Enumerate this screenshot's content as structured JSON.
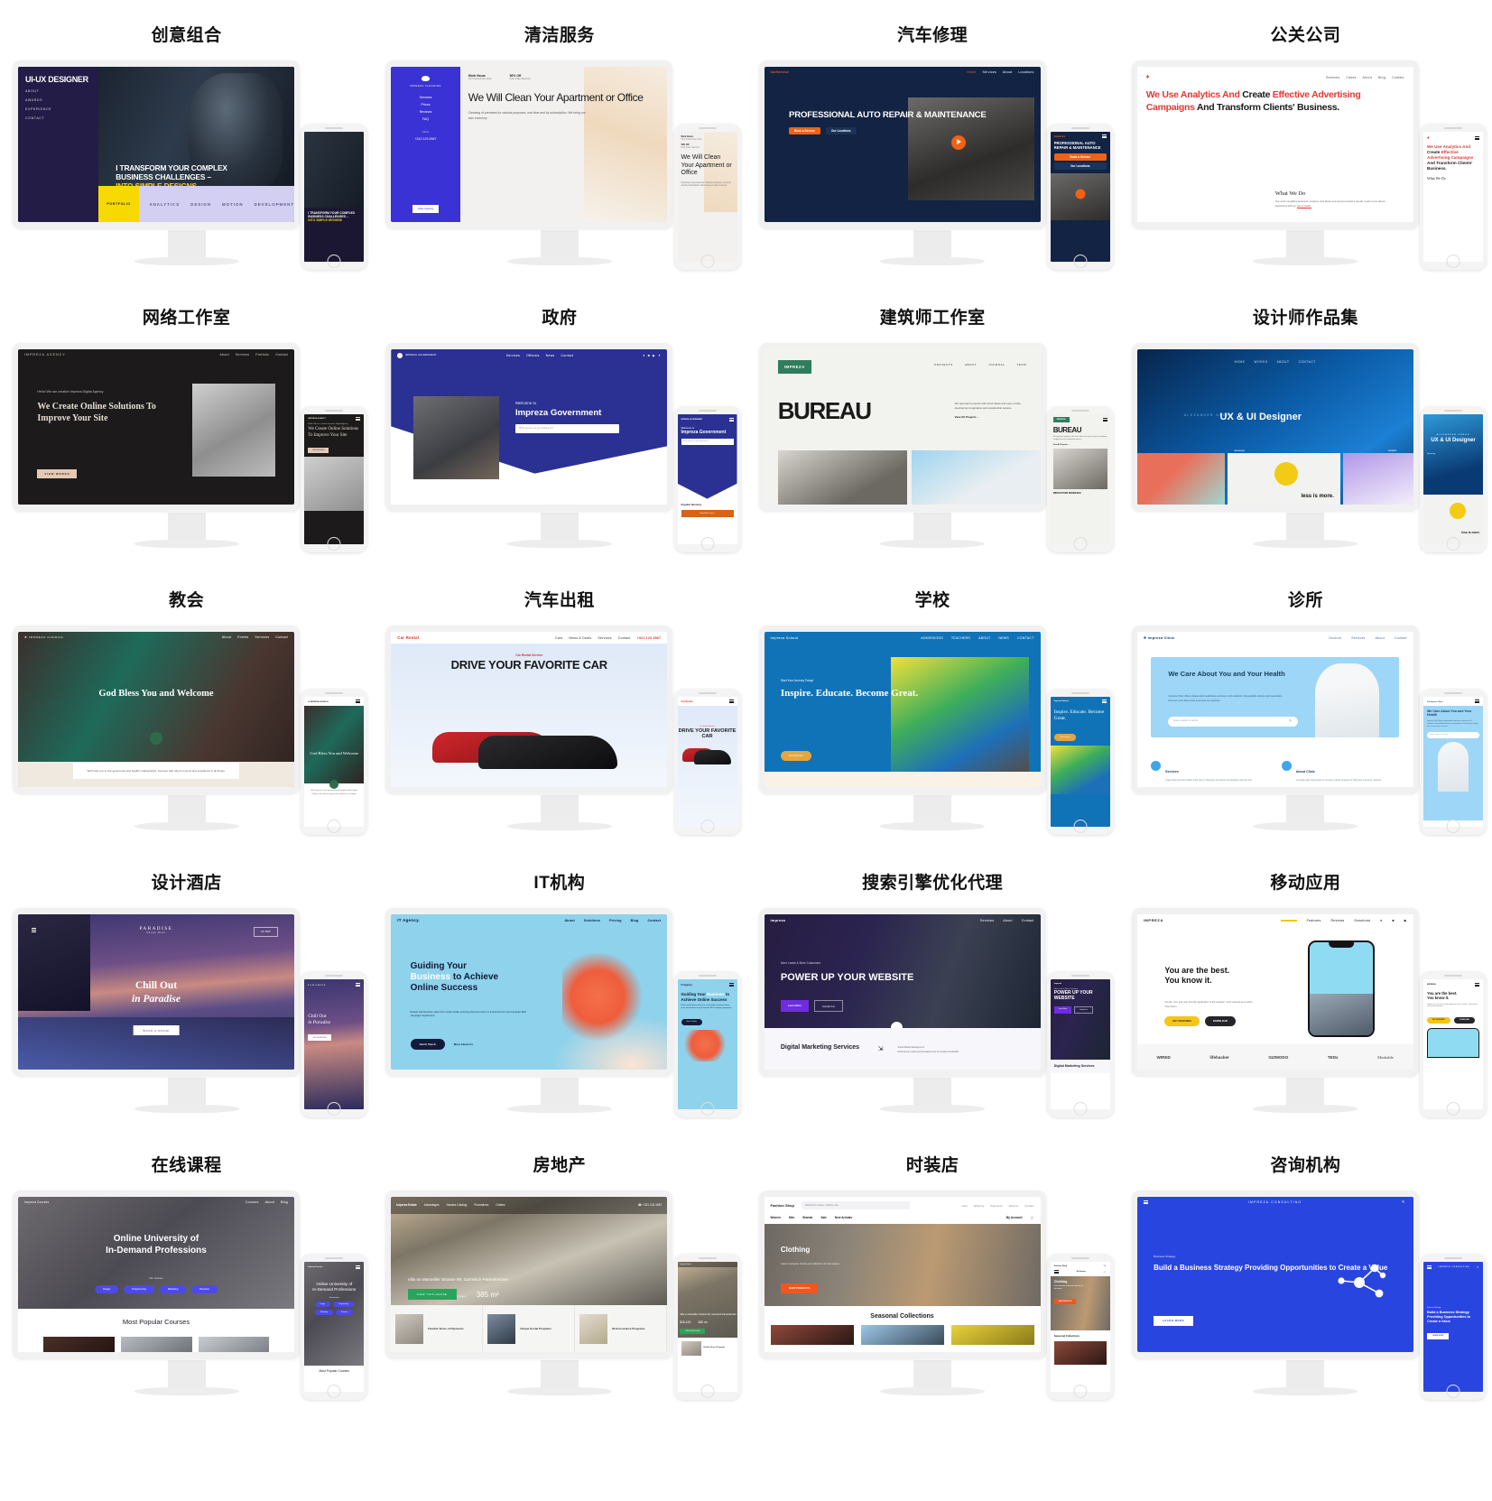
{
  "layout": {
    "columns": 4,
    "rows": 5
  },
  "cells": [
    {
      "title": "创意组合",
      "site": {
        "logo": "UI-UX DESIGNER",
        "menu": [
          "ABOUT",
          "AWARDS",
          "EXPERIENCE",
          "CONTACT"
        ],
        "heading_line1": "I TRANSFORM YOUR COMPLEX",
        "heading_line2": "BUSINESS CHALLENGES –",
        "heading_accent": "INTO SIMPLE DESIGNS",
        "footer_tag": "PORTFOLIO",
        "footer_items": [
          "ANALYTICS",
          "DESIGN",
          "MOTION",
          "DEVELOPMENT"
        ],
        "accent": "#f5d900",
        "bg": "#221c46"
      }
    },
    {
      "title": "清洁服务",
      "site": {
        "logo": "IMPREZA CLEANING",
        "menu": [
          "Services",
          "Prices",
          "Reviews",
          "FAQ"
        ],
        "phone_label": "Call Us",
        "phone": "+312 123 4567",
        "badge1_title": "Work Hours",
        "badge1_text": "24/7 Around the clock",
        "badge2_title": "50% Off",
        "badge2_text": "First order discount",
        "heading": "We Will Clean Your Apartment or Office",
        "paragraph": "Cleaning of premises for various purposes, one-time and by subscription. We bring our own inventory",
        "cta": "Order Cleaning",
        "accent": "#3a32d4"
      }
    },
    {
      "title": "汽车修理",
      "site": {
        "logo": "CarService",
        "menu": [
          "Home",
          "Services",
          "About",
          "Locations"
        ],
        "heading": "PROFESSIONAL AUTO REPAIR & MAINTENANCE",
        "cta_primary": "Book a Service",
        "cta_secondary": "Our Locations",
        "accent": "#ef6216",
        "bg": "#122343"
      }
    },
    {
      "title": "公关公司",
      "site": {
        "logo": "diamond-logo",
        "menu": [
          "Services",
          "Cases",
          "About",
          "Blog",
          "Contact"
        ],
        "heading_parts": [
          {
            "text": "We Use Analytics And ",
            "accent": true
          },
          {
            "text": "Create ",
            "accent": false
          },
          {
            "text": "Effective Advertising Campaigns ",
            "accent": true
          },
          {
            "text": "And Transform Clients' Business.",
            "accent": false
          }
        ],
        "section_title": "What We Do",
        "section_text": "Our work simplifies business, inspires new ideas and serves people's needs. Learn more about partnering with us,",
        "section_link": "get in touch.",
        "accent": "#e03a35"
      }
    },
    {
      "title": "网络工作室",
      "site": {
        "logo": "IMPREZA AGENCY",
        "menu": [
          "About",
          "Services",
          "Portfolio",
          "Contact"
        ],
        "eyebrow": "Hello! We are creative Impreza Digital Agency",
        "heading": "We Create Online Solutions To Improve Your Site",
        "cta": "VIEW WORKS",
        "accent": "#e3c9b4",
        "bg": "#1c1a1b"
      }
    },
    {
      "title": "政府",
      "site": {
        "logo": "IMPREZA GOVERNMENT",
        "menu": [
          "Services",
          "Officials",
          "News",
          "Contact"
        ],
        "eyebrow": "Welcome to",
        "heading": "Impreza Government",
        "search_placeholder": "What service are you looking for?",
        "mobile_section": "Popular Services",
        "mobile_cta": "View All Services",
        "accent": "#2a3192"
      }
    },
    {
      "title": "建筑师工作室",
      "site": {
        "logo": "IMPREZA",
        "menu": [
          "PROJECTS",
          "ABOUT",
          "JOURNAL",
          "TEAM"
        ],
        "heading": "BUREAU",
        "paragraph": "We approach projects with fresh ideas and open minds, developing imaginative and sustainable spaces.",
        "link": "View All Projects",
        "mobile_caption": "MIDDLETOWN RESIDENCE",
        "accent": "#2f7d5d"
      }
    },
    {
      "title": "设计师作品集",
      "site": {
        "menu": [
          "HOME",
          "WORKS",
          "ABOUT",
          "CONTACT"
        ],
        "name": "ALEXANDER GREEN",
        "heading": "UX & UI Designer",
        "work1": "Jamescop",
        "work2": "Carpitch",
        "work_quote": "less is more.",
        "accent": "#1c80d4"
      }
    },
    {
      "title": "教会",
      "site": {
        "logo": "IMPREZA CHURCH",
        "menu": [
          "About",
          "Events",
          "Sermons",
          "Contact"
        ],
        "heading": "God Bless You and Welcome",
        "card_text": "We'll help you to live generously and healthy relationships. Connect with others to grow and excellence in all things.",
        "accent": "#2f6b4a"
      }
    },
    {
      "title": "汽车出租",
      "site": {
        "logo": "Car Rental",
        "menu": [
          "Cars",
          "News & Deals",
          "Services",
          "Contact"
        ],
        "phone": "+321 123 4567",
        "eyebrow": "Car Rental Service",
        "heading": "DRIVE YOUR FAVORITE CAR",
        "accent": "#e12b2b"
      }
    },
    {
      "title": "学校",
      "site": {
        "logo": "Impreza School",
        "menu": [
          "ADMISSIONS",
          "TEACHERS",
          "ABOUT",
          "NEWS",
          "CONTACT"
        ],
        "eyebrow": "Start Your Journey Today!",
        "heading": "Inspire. Educate. Become Great.",
        "cta": "Find School",
        "accent": "#1073b8",
        "cta_color": "#e4a63f"
      }
    },
    {
      "title": "诊所",
      "site": {
        "logo": "Impreza Clinic",
        "menu": [
          "Doctors",
          "Services",
          "About",
          "Contact"
        ],
        "heading": "We Care About You and Your Health",
        "paragraph": "Impreza Clinic offers independent healthcare services to all residents. Dependable doctors and specialists. Find out more about how to access our services.",
        "search_placeholder": "Enter a doctor or service",
        "card1_title": "Services",
        "card1_text": "Organically grow the holistic world view of disruptive innovation via workplace diversity and",
        "card2_title": "About Clinic",
        "card2_text": "Leverage agile frameworks to provide a robust synopsis for high level overviews. Iterative",
        "accent": "#9ed6f7"
      }
    },
    {
      "title": "设计酒店",
      "site": {
        "logo": "PARADISE",
        "logo_sub": "Design Hotel",
        "heading_line1": "Chill Out",
        "heading_line2": "in Paradise",
        "cta": "BOOK A ROOM",
        "menu_button": "MY TRIP",
        "accent": "#c98a82"
      }
    },
    {
      "title": "IT机构",
      "site": {
        "logo": "IT Agency.",
        "menu": [
          "About",
          "Solutions",
          "Pricing",
          "Blog",
          "Contact"
        ],
        "heading_line1": "Guiding Your",
        "heading_accent": "Business",
        "heading_line2": " to Achieve",
        "heading_line3": "Online Success",
        "paragraph": "Extract real business value from social media, ensuring the best return on investment for your bespoke SEO campaign requirement.",
        "cta_primary": "Get In Touch",
        "cta_secondary": "More About Us",
        "accent": "#8ed2ec"
      }
    },
    {
      "title": "搜索引擎优化代理",
      "site": {
        "logo": "impreza",
        "menu": [
          "Services",
          "About",
          "Contact"
        ],
        "eyebrow": "More Leads & More Customers",
        "heading": "POWER UP YOUR WEBSITE",
        "cta_primary": "Learn More",
        "cta_secondary": "Contact Us",
        "section_title": "Digital Marketing Services",
        "feature_title": "Social Media Management",
        "feature_text": "Distinctively exploit optimal alignments for intuitive bandwidth.",
        "accent": "#6f2ce0"
      }
    },
    {
      "title": "移动应用",
      "site": {
        "logo": "IMPREZA",
        "menu": [
          "Home",
          "Features",
          "Reviews",
          "Download"
        ],
        "heading_line1": "You are the best.",
        "heading_line2": "You know it.",
        "paragraph": "Simple, nice and user friendly application of the weather. Only relevant and useful information.",
        "cta_primary": "KEY FEATURES",
        "cta_secondary": "DOWNLOAD",
        "press_logos": [
          "WIRED",
          "lifehacker",
          "GIZMODO",
          "TEDx",
          "Mashable"
        ],
        "accent": "#f5c518"
      }
    },
    {
      "title": "在线课程",
      "site": {
        "logo": "Impreza Courses",
        "menu": [
          "Courses",
          "About",
          "Blog"
        ],
        "heading_line1": "Online University of",
        "heading_line2": "In-Demand Professions",
        "courses_label": "Our courses",
        "pills": [
          "Design",
          "Programming",
          "Marketing",
          "Business"
        ],
        "section_title": "Most Popular Courses",
        "accent": "#4c4ae6"
      }
    },
    {
      "title": "房地产",
      "site": {
        "logo": "Impreza Estate",
        "menu": [
          "Advantages",
          "Houses Catalog",
          "Promotions",
          "Guides"
        ],
        "phone": "+321 123 4567",
        "address": "Villa on Marseiller Strasse 99, Garmisch-Partenkirchen",
        "price": "$26,100",
        "price_note": "Including Taxes",
        "area": "385 m²",
        "cta": "VIEW THIS HOUSE",
        "features": [
          "Flexible Terms of Payments",
          "Unique Social Programs",
          "Risk Insurance Programs"
        ],
        "accent": "#2aa45c"
      }
    },
    {
      "title": "时装店",
      "site": {
        "logo": "Fashion Shop",
        "search_placeholder": "Search for shoes, clothes, etc.",
        "top_links": [
          "Help",
          "Shipping",
          "Payments",
          "Returns",
          "Contact"
        ],
        "categories": [
          "Women",
          "Men",
          "Brands",
          "Sale",
          "New Arrivals"
        ],
        "account": "My Account",
        "banner_title": "Clothing",
        "banner_text": "Latest menswear trends and collections for this season",
        "banner_cta": "SHOP PRODUCTS",
        "section_title": "Seasonal Collections",
        "accent": "#f2561d"
      }
    },
    {
      "title": "咨询机构",
      "site": {
        "logo": "IMPREZA CONSULTING",
        "eyebrow": "Business Strategy",
        "heading": "Build a Business Strategy Providing Opportunities to Create a Value",
        "cta": "LEARN MORE",
        "accent": "#2945e0"
      }
    }
  ]
}
